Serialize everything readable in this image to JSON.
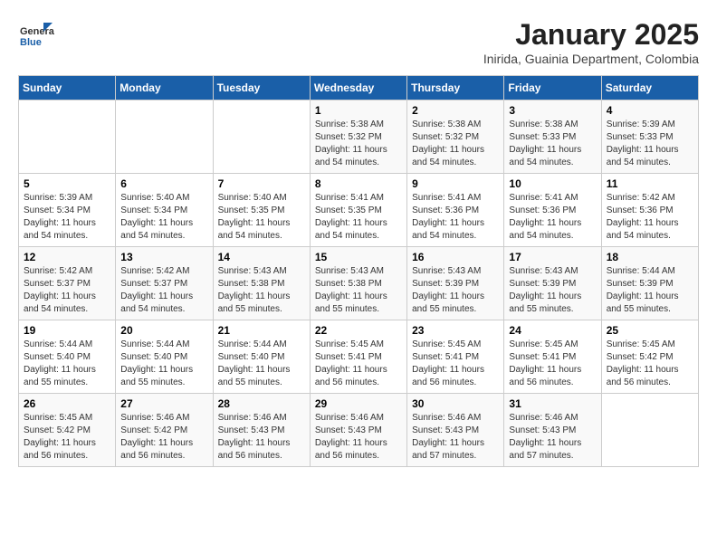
{
  "header": {
    "logo_general": "General",
    "logo_blue": "Blue",
    "month_title": "January 2025",
    "subtitle": "Inirida, Guainia Department, Colombia"
  },
  "days_of_week": [
    "Sunday",
    "Monday",
    "Tuesday",
    "Wednesday",
    "Thursday",
    "Friday",
    "Saturday"
  ],
  "weeks": [
    [
      {
        "day": "",
        "info": ""
      },
      {
        "day": "",
        "info": ""
      },
      {
        "day": "",
        "info": ""
      },
      {
        "day": "1",
        "info": "Sunrise: 5:38 AM\nSunset: 5:32 PM\nDaylight: 11 hours\nand 54 minutes."
      },
      {
        "day": "2",
        "info": "Sunrise: 5:38 AM\nSunset: 5:32 PM\nDaylight: 11 hours\nand 54 minutes."
      },
      {
        "day": "3",
        "info": "Sunrise: 5:38 AM\nSunset: 5:33 PM\nDaylight: 11 hours\nand 54 minutes."
      },
      {
        "day": "4",
        "info": "Sunrise: 5:39 AM\nSunset: 5:33 PM\nDaylight: 11 hours\nand 54 minutes."
      }
    ],
    [
      {
        "day": "5",
        "info": "Sunrise: 5:39 AM\nSunset: 5:34 PM\nDaylight: 11 hours\nand 54 minutes."
      },
      {
        "day": "6",
        "info": "Sunrise: 5:40 AM\nSunset: 5:34 PM\nDaylight: 11 hours\nand 54 minutes."
      },
      {
        "day": "7",
        "info": "Sunrise: 5:40 AM\nSunset: 5:35 PM\nDaylight: 11 hours\nand 54 minutes."
      },
      {
        "day": "8",
        "info": "Sunrise: 5:41 AM\nSunset: 5:35 PM\nDaylight: 11 hours\nand 54 minutes."
      },
      {
        "day": "9",
        "info": "Sunrise: 5:41 AM\nSunset: 5:36 PM\nDaylight: 11 hours\nand 54 minutes."
      },
      {
        "day": "10",
        "info": "Sunrise: 5:41 AM\nSunset: 5:36 PM\nDaylight: 11 hours\nand 54 minutes."
      },
      {
        "day": "11",
        "info": "Sunrise: 5:42 AM\nSunset: 5:36 PM\nDaylight: 11 hours\nand 54 minutes."
      }
    ],
    [
      {
        "day": "12",
        "info": "Sunrise: 5:42 AM\nSunset: 5:37 PM\nDaylight: 11 hours\nand 54 minutes."
      },
      {
        "day": "13",
        "info": "Sunrise: 5:42 AM\nSunset: 5:37 PM\nDaylight: 11 hours\nand 54 minutes."
      },
      {
        "day": "14",
        "info": "Sunrise: 5:43 AM\nSunset: 5:38 PM\nDaylight: 11 hours\nand 55 minutes."
      },
      {
        "day": "15",
        "info": "Sunrise: 5:43 AM\nSunset: 5:38 PM\nDaylight: 11 hours\nand 55 minutes."
      },
      {
        "day": "16",
        "info": "Sunrise: 5:43 AM\nSunset: 5:39 PM\nDaylight: 11 hours\nand 55 minutes."
      },
      {
        "day": "17",
        "info": "Sunrise: 5:43 AM\nSunset: 5:39 PM\nDaylight: 11 hours\nand 55 minutes."
      },
      {
        "day": "18",
        "info": "Sunrise: 5:44 AM\nSunset: 5:39 PM\nDaylight: 11 hours\nand 55 minutes."
      }
    ],
    [
      {
        "day": "19",
        "info": "Sunrise: 5:44 AM\nSunset: 5:40 PM\nDaylight: 11 hours\nand 55 minutes."
      },
      {
        "day": "20",
        "info": "Sunrise: 5:44 AM\nSunset: 5:40 PM\nDaylight: 11 hours\nand 55 minutes."
      },
      {
        "day": "21",
        "info": "Sunrise: 5:44 AM\nSunset: 5:40 PM\nDaylight: 11 hours\nand 55 minutes."
      },
      {
        "day": "22",
        "info": "Sunrise: 5:45 AM\nSunset: 5:41 PM\nDaylight: 11 hours\nand 56 minutes."
      },
      {
        "day": "23",
        "info": "Sunrise: 5:45 AM\nSunset: 5:41 PM\nDaylight: 11 hours\nand 56 minutes."
      },
      {
        "day": "24",
        "info": "Sunrise: 5:45 AM\nSunset: 5:41 PM\nDaylight: 11 hours\nand 56 minutes."
      },
      {
        "day": "25",
        "info": "Sunrise: 5:45 AM\nSunset: 5:42 PM\nDaylight: 11 hours\nand 56 minutes."
      }
    ],
    [
      {
        "day": "26",
        "info": "Sunrise: 5:45 AM\nSunset: 5:42 PM\nDaylight: 11 hours\nand 56 minutes."
      },
      {
        "day": "27",
        "info": "Sunrise: 5:46 AM\nSunset: 5:42 PM\nDaylight: 11 hours\nand 56 minutes."
      },
      {
        "day": "28",
        "info": "Sunrise: 5:46 AM\nSunset: 5:43 PM\nDaylight: 11 hours\nand 56 minutes."
      },
      {
        "day": "29",
        "info": "Sunrise: 5:46 AM\nSunset: 5:43 PM\nDaylight: 11 hours\nand 56 minutes."
      },
      {
        "day": "30",
        "info": "Sunrise: 5:46 AM\nSunset: 5:43 PM\nDaylight: 11 hours\nand 57 minutes."
      },
      {
        "day": "31",
        "info": "Sunrise: 5:46 AM\nSunset: 5:43 PM\nDaylight: 11 hours\nand 57 minutes."
      },
      {
        "day": "",
        "info": ""
      }
    ]
  ]
}
